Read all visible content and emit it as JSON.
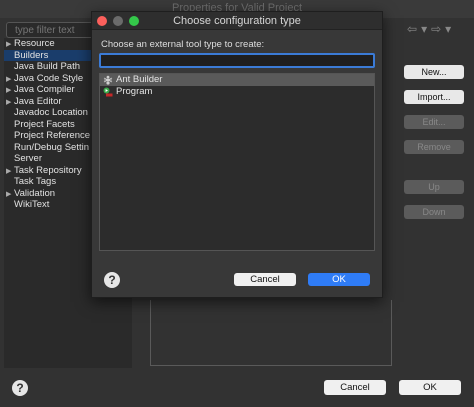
{
  "background_window": {
    "title": "Properties for Valid Project",
    "filter_placeholder": "type filter text",
    "tree": [
      {
        "label": "Resource",
        "expandable": true,
        "selected": false
      },
      {
        "label": "Builders",
        "expandable": false,
        "selected": true
      },
      {
        "label": "Java Build Path",
        "expandable": false,
        "selected": false
      },
      {
        "label": "Java Code Style",
        "expandable": true,
        "selected": false
      },
      {
        "label": "Java Compiler",
        "expandable": true,
        "selected": false
      },
      {
        "label": "Java Editor",
        "expandable": true,
        "selected": false
      },
      {
        "label": "Javadoc Location",
        "expandable": false,
        "selected": false
      },
      {
        "label": "Project Facets",
        "expandable": false,
        "selected": false
      },
      {
        "label": "Project Reference",
        "expandable": false,
        "selected": false
      },
      {
        "label": "Run/Debug Settin",
        "expandable": false,
        "selected": false
      },
      {
        "label": "Server",
        "expandable": false,
        "selected": false
      },
      {
        "label": "Task Repository",
        "expandable": true,
        "selected": false
      },
      {
        "label": "Task Tags",
        "expandable": false,
        "selected": false
      },
      {
        "label": "Validation",
        "expandable": true,
        "selected": false
      },
      {
        "label": "WikiText",
        "expandable": false,
        "selected": false
      }
    ],
    "side_buttons": {
      "new": "New...",
      "import": "Import...",
      "edit": "Edit...",
      "remove": "Remove",
      "up": "Up",
      "down": "Down"
    },
    "help_symbol": "?",
    "cancel_label": "Cancel",
    "ok_label": "OK",
    "nav": {
      "back": "⇦",
      "back_menu": "▾",
      "forward": "⇨",
      "forward_menu": "▾"
    }
  },
  "dialog": {
    "title": "Choose configuration type",
    "prompt": "Choose an external tool type to create:",
    "search_value": "",
    "items": [
      {
        "label": "Ant Builder",
        "icon": "ant-icon",
        "selected": true
      },
      {
        "label": "Program",
        "icon": "program-icon",
        "selected": false
      }
    ],
    "help_symbol": "?",
    "cancel_label": "Cancel",
    "ok_label": "OK"
  },
  "colors": {
    "accent": "#2f7cf6",
    "close": "#fc605c",
    "maximize": "#34c84a"
  }
}
